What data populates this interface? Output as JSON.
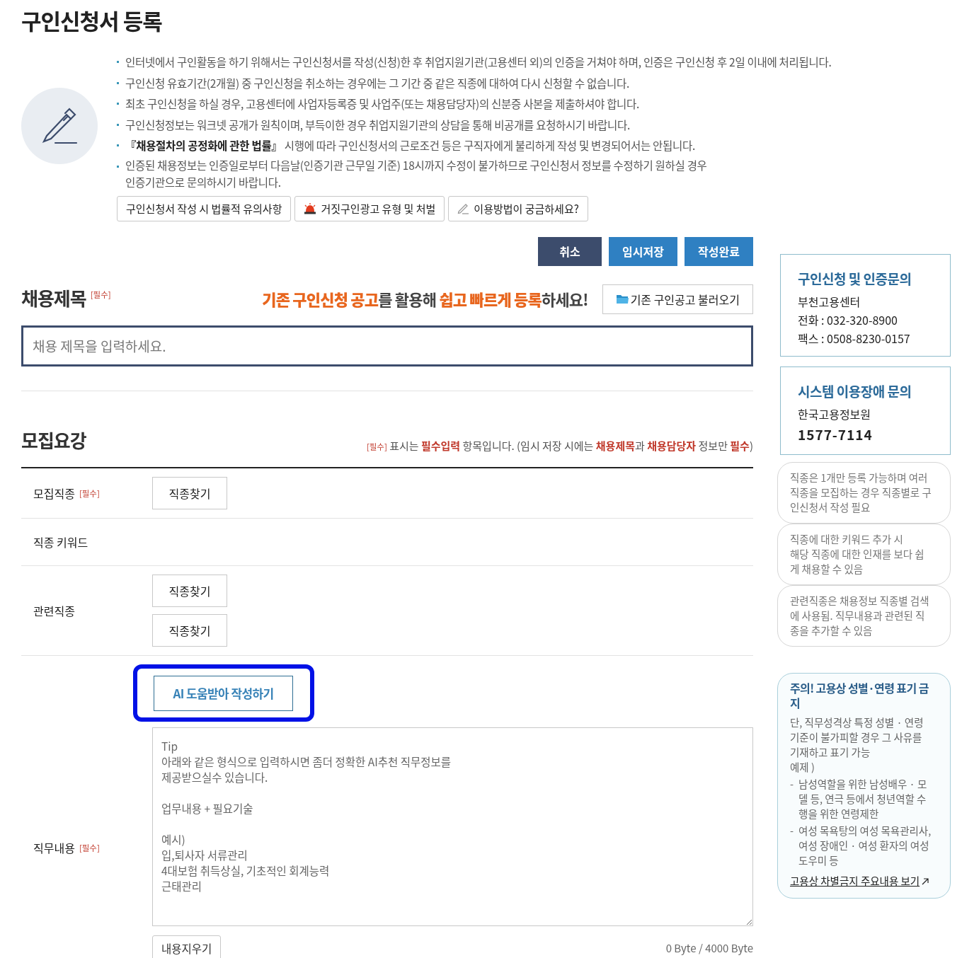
{
  "page_title": "구인신청서 등록",
  "notices": [
    "인터넷에서 구인활동을 하기 위해서는 구인신청서를 작성(신청)한 후 취업지원기관(고용센터 외)의 인증을 거쳐야 하며, 인증은 구인신청 후 2일 이내에 처리됩니다.",
    "구인신청 유효기간(2개월) 중 구인신청을 취소하는 경우에는 그 기간 중 같은 직종에 대하여 다시 신청할 수 없습니다.",
    "최초 구인신청을 하실 경우, 고용센터에 사업자등록증 및 사업주(또는 채용담당자)의 신분증 사본을 제출하셔야 합니다.",
    "구인신청정보는 워크넷 공개가 원칙이며, 부득이한 경우 취업지원기관의 상담을 통해 비공개를 요청하시기 바랍니다.",
    "**『채용절차의 공정화에 관한 법률』** 시행에 따라 구인신청서의 근로조건 등은 구직자에게 불리하게 작성 및 변경되어서는 안됩니다.",
    "인증된 채용정보는 인증일로부터 다음날(인증기관 근무일 기준) 18시까지 수정이 불가하므로 구인신청서 정보를 수정하기 원하실 경우\n인증기관으로 문의하시기 바랍니다."
  ],
  "info_buttons": [
    {
      "label": "구인신청서 작성 시 법률적 유의사항",
      "kind": "plain"
    },
    {
      "label": "거짓구인광고 유형 및 처벌",
      "kind": "siren"
    },
    {
      "label": "이용방법이 궁금하세요?",
      "kind": "pencil"
    }
  ],
  "actions": [
    {
      "label": "취소",
      "kind": "dark"
    },
    {
      "label": "임시저장",
      "kind": "blue"
    },
    {
      "label": "작성완료",
      "kind": "blue"
    }
  ],
  "title_section": {
    "heading": "채용제목",
    "required": "[필수]",
    "promo": "**기존 구인신청 공고**를 활용해 **쉽고 빠르게 등록**하세요!",
    "load_button": "기존 구인공고 불러오기",
    "placeholder": "채용 제목을 입력하세요."
  },
  "recruit_section": {
    "heading": "모집요강",
    "legend": [
      {
        "text": "[필수]",
        "kind": "tag"
      },
      {
        "text": " 표시는 ",
        "kind": "plain"
      },
      {
        "text": "필수입력",
        "kind": "red"
      },
      {
        "text": " 항목입니다. (임시 저장 시에는 ",
        "kind": "plain"
      },
      {
        "text": "채용제목",
        "kind": "red"
      },
      {
        "text": "과 ",
        "kind": "plain"
      },
      {
        "text": "채용담당자",
        "kind": "red"
      },
      {
        "text": " 정보만 ",
        "kind": "plain"
      },
      {
        "text": "필수",
        "kind": "red"
      },
      {
        "text": ")",
        "kind": "plain"
      }
    ],
    "rows": [
      {
        "label": "모집직종",
        "required": "[필수]",
        "buttons": [
          "직종찾기"
        ]
      },
      {
        "label": "직종 키워드"
      },
      {
        "label": "관련직종",
        "buttons": [
          "직종찾기",
          "직종찾기"
        ]
      }
    ],
    "ai_button": {
      "label": "AI 도움받아 작성하기",
      "highlighted": true
    },
    "duty": {
      "label": "직무내용",
      "required": "[필수]",
      "placeholder": "Tip\n아래와 같은 형식으로 입력하시면 좀더 정확한 AI추천 직무정보를\n제공받으실수 있습니다.\n\n업무내용 + 필요기술\n\n예시)\n입,퇴사자 서류관리\n4대보험 취득상실, 기초적인 회계능력\n근태관리",
      "clear_button": "내용지우기",
      "byte_count": "0 Byte / 4000 Byte"
    }
  },
  "contacts": [
    {
      "title": "구인신청 및 인증문의",
      "lines": [
        {
          "text": "부천고용센터",
          "kind": "plain"
        },
        {
          "text": "전화 : 032-320-8900",
          "kind": "plain"
        },
        {
          "text": "팩스 : 0508-8230-0157",
          "kind": "plain"
        }
      ]
    },
    {
      "title": "시스템 이용장애 문의",
      "lines": [
        {
          "text": "한국고용정보원",
          "kind": "plain"
        },
        {
          "text": "1577-7114",
          "kind": "big"
        }
      ]
    }
  ],
  "tips": [
    {
      "text": "직종은 1개만 등록 가능하며 여러 직종을 모집하는 경우 직종별로 구인신청서 작성 필요"
    },
    {
      "text": "직종에 대한 키워드 추가 시\n해당 직종에 대한 인재를 보다 쉽게 채용할 수 있음"
    },
    {
      "text": "관련직종은 채용정보 직종별 검색에 사용됨. 직무내용과 관련된 직종을 추가할 수 있음"
    }
  ],
  "caution": {
    "title": "주의! 고용상 성별·연령 표기 금지",
    "body": "단, 직무성격상 특정 성별 · 연령 기준이 불가피할 경우 그 사유를 기재하고 표기 가능",
    "example_label": "예제 )",
    "example_marker": "-",
    "examples": [
      "남성역할을 위한 남성배우 · 모델 등, 연극 등에서 청년역할 수행을 위한 연령제한",
      "여성 목욕탕의 여성 목욕관리사, 여성 장애인 · 여성 환자의 여성 도우미 등"
    ],
    "link": "고용상 차별금지 주요내용 보기"
  }
}
